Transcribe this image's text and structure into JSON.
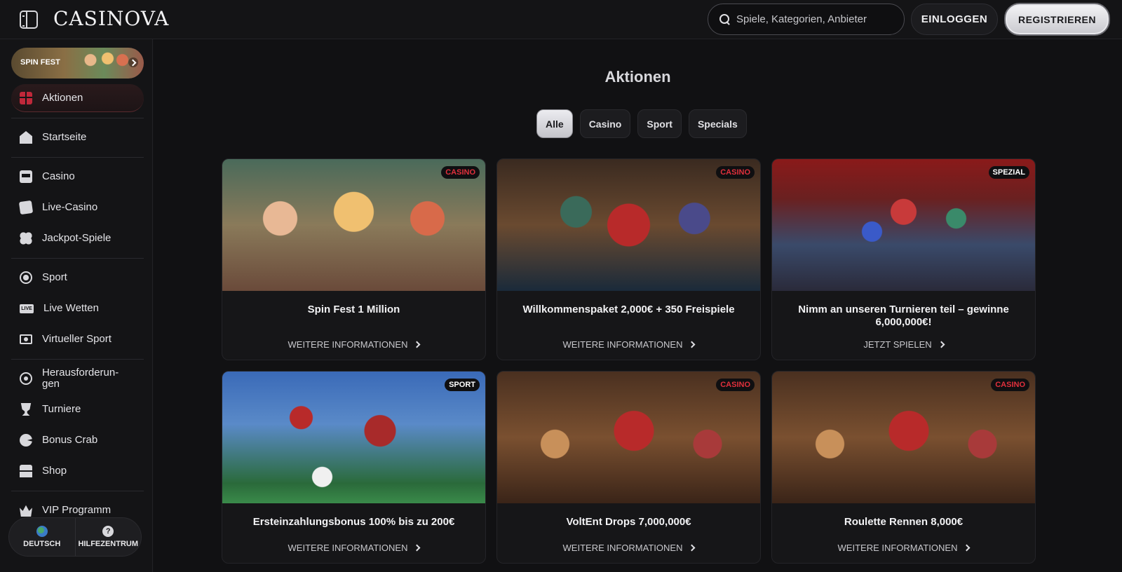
{
  "header": {
    "logo": "CASINOVA",
    "search_placeholder": "Spiele, Kategorien, Anbieter",
    "login_label": "EINLOGGEN",
    "register_label": "REGISTRIEREN"
  },
  "sidebar": {
    "promo_banner": "SPIN FEST",
    "items": [
      {
        "label": "Aktionen",
        "icon": "gift-icon"
      },
      {
        "label": "Startseite",
        "icon": "house-icon"
      },
      {
        "label": "Casino",
        "icon": "slot-machine-icon"
      },
      {
        "label": "Live-Casino",
        "icon": "cards-icon"
      },
      {
        "label": "Jackpot-Spiele",
        "icon": "clover-icon"
      },
      {
        "label": "Sport",
        "icon": "soccer-ball-icon"
      },
      {
        "label": "Live Wetten",
        "icon": "live-icon"
      },
      {
        "label": "Virtueller Sport",
        "icon": "monitor-icon"
      },
      {
        "label": "Herausforderun-\ngen",
        "icon": "target-icon"
      },
      {
        "label": "Turniere",
        "icon": "trophy-icon"
      },
      {
        "label": "Bonus Crab",
        "icon": "crab-icon"
      },
      {
        "label": "Shop",
        "icon": "shop-icon"
      },
      {
        "label": "VIP Programm",
        "icon": "crown-icon"
      }
    ],
    "footer": {
      "language": "DEUTSCH",
      "help": "HILFEZENTRUM",
      "help_glyph": "?"
    }
  },
  "main": {
    "title": "Aktionen",
    "tabs": [
      "Alle",
      "Casino",
      "Sport",
      "Specials"
    ],
    "active_tab": "Alle",
    "cards": [
      {
        "badge": "CASINO",
        "title": "Spin Fest 1 Million",
        "link": "WEITERE INFORMATIONEN"
      },
      {
        "badge": "CASINO",
        "title": "Willkommenspaket 2,000€ + 350 Freispiele",
        "link": "WEITERE INFORMATIONEN"
      },
      {
        "badge": "SPEZIAL",
        "title": "Nimm an unseren Turnieren teil – gewinne 6,000,000€!",
        "link": "JETZT SPIELEN"
      },
      {
        "badge": "SPORT",
        "title": "Ersteinzahlungsbonus 100% bis zu 200€",
        "link": "WEITERE INFORMATIONEN"
      },
      {
        "badge": "CASINO",
        "title": "VoltEnt Drops 7,000,000€",
        "link": "WEITERE INFORMATIONEN"
      },
      {
        "badge": "CASINO",
        "title": "Roulette Rennen 8,000€",
        "link": "WEITERE INFORMATIONEN"
      }
    ]
  },
  "colors": {
    "accent_red": "#e0303c",
    "background": "#111113"
  }
}
